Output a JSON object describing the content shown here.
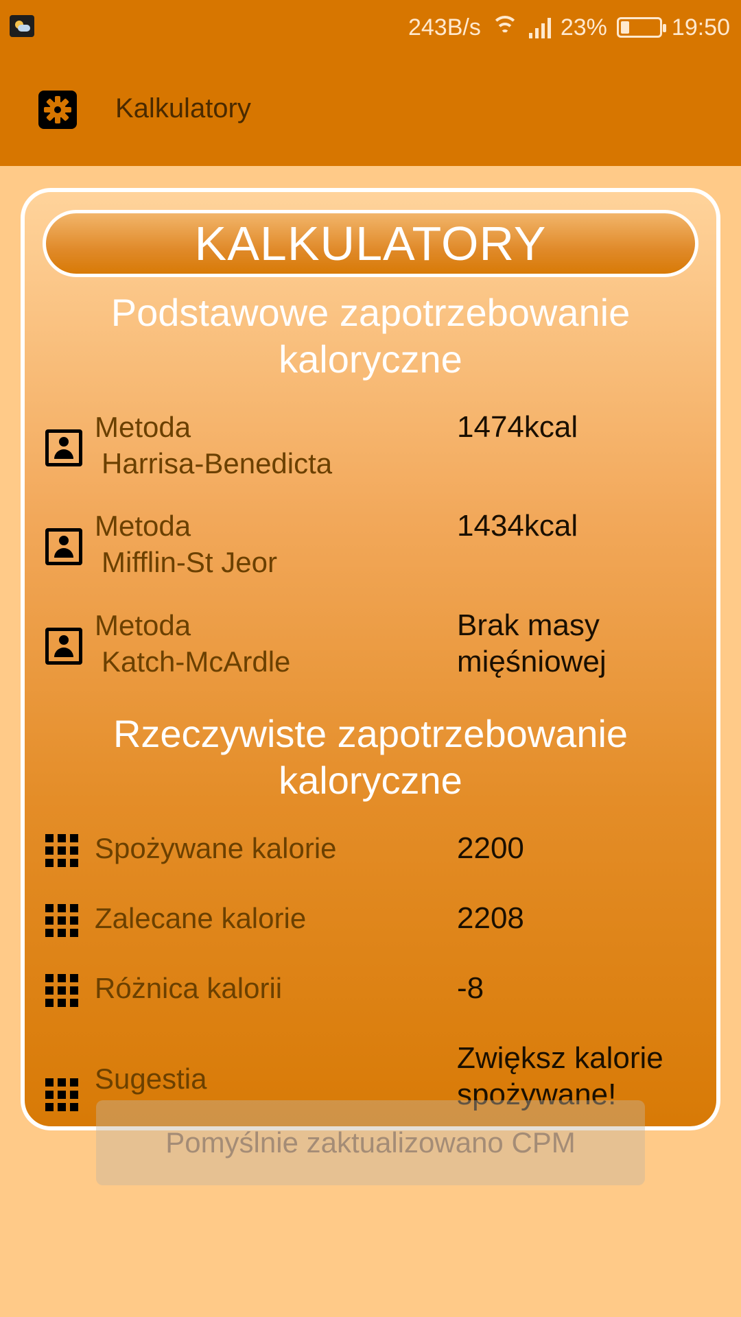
{
  "status_bar": {
    "network_speed": "243B/s",
    "battery_percent": "23%",
    "battery_level": 0.23,
    "time": "19:50",
    "icons": [
      "weather-icon",
      "wifi-icon",
      "signal-icon",
      "battery-icon"
    ]
  },
  "toolbar": {
    "title": "Kalkulatory",
    "settings_icon": "gear-icon"
  },
  "card": {
    "header": "KALKULATORY",
    "basic_section": {
      "title": "Podstawowe zapotrzebowanie kaloryczne",
      "rows": [
        {
          "label_line1": "Metoda",
          "label_line2": "Harrisa-Benedicta",
          "value": "1474kcal",
          "icon": "contact-icon"
        },
        {
          "label_line1": "Metoda",
          "label_line2": "Mifflin-St Jeor",
          "value": "1434kcal",
          "icon": "contact-icon"
        },
        {
          "label_line1": "Metoda",
          "label_line2": "Katch-McArdle",
          "value_line1": "Brak masy",
          "value_line2": "mięśniowej",
          "icon": "contact-icon"
        }
      ]
    },
    "actual_section": {
      "title": "Rzeczywiste zapotrzebowanie kaloryczne",
      "rows": [
        {
          "label": "Spożywane kalorie",
          "value": "2200",
          "icon": "grid-icon"
        },
        {
          "label": "Zalecane kalorie",
          "value": "2208",
          "icon": "grid-icon"
        },
        {
          "label": "Różnica kalorii",
          "value": "-8",
          "icon": "grid-icon"
        },
        {
          "label": "Sugestia",
          "value_line1": "Zwiększ kalorie",
          "value_line2": "spożywane!",
          "icon": "grid-icon"
        }
      ]
    }
  },
  "toast": {
    "message": "Pomyślnie zaktualizowano CPM"
  }
}
